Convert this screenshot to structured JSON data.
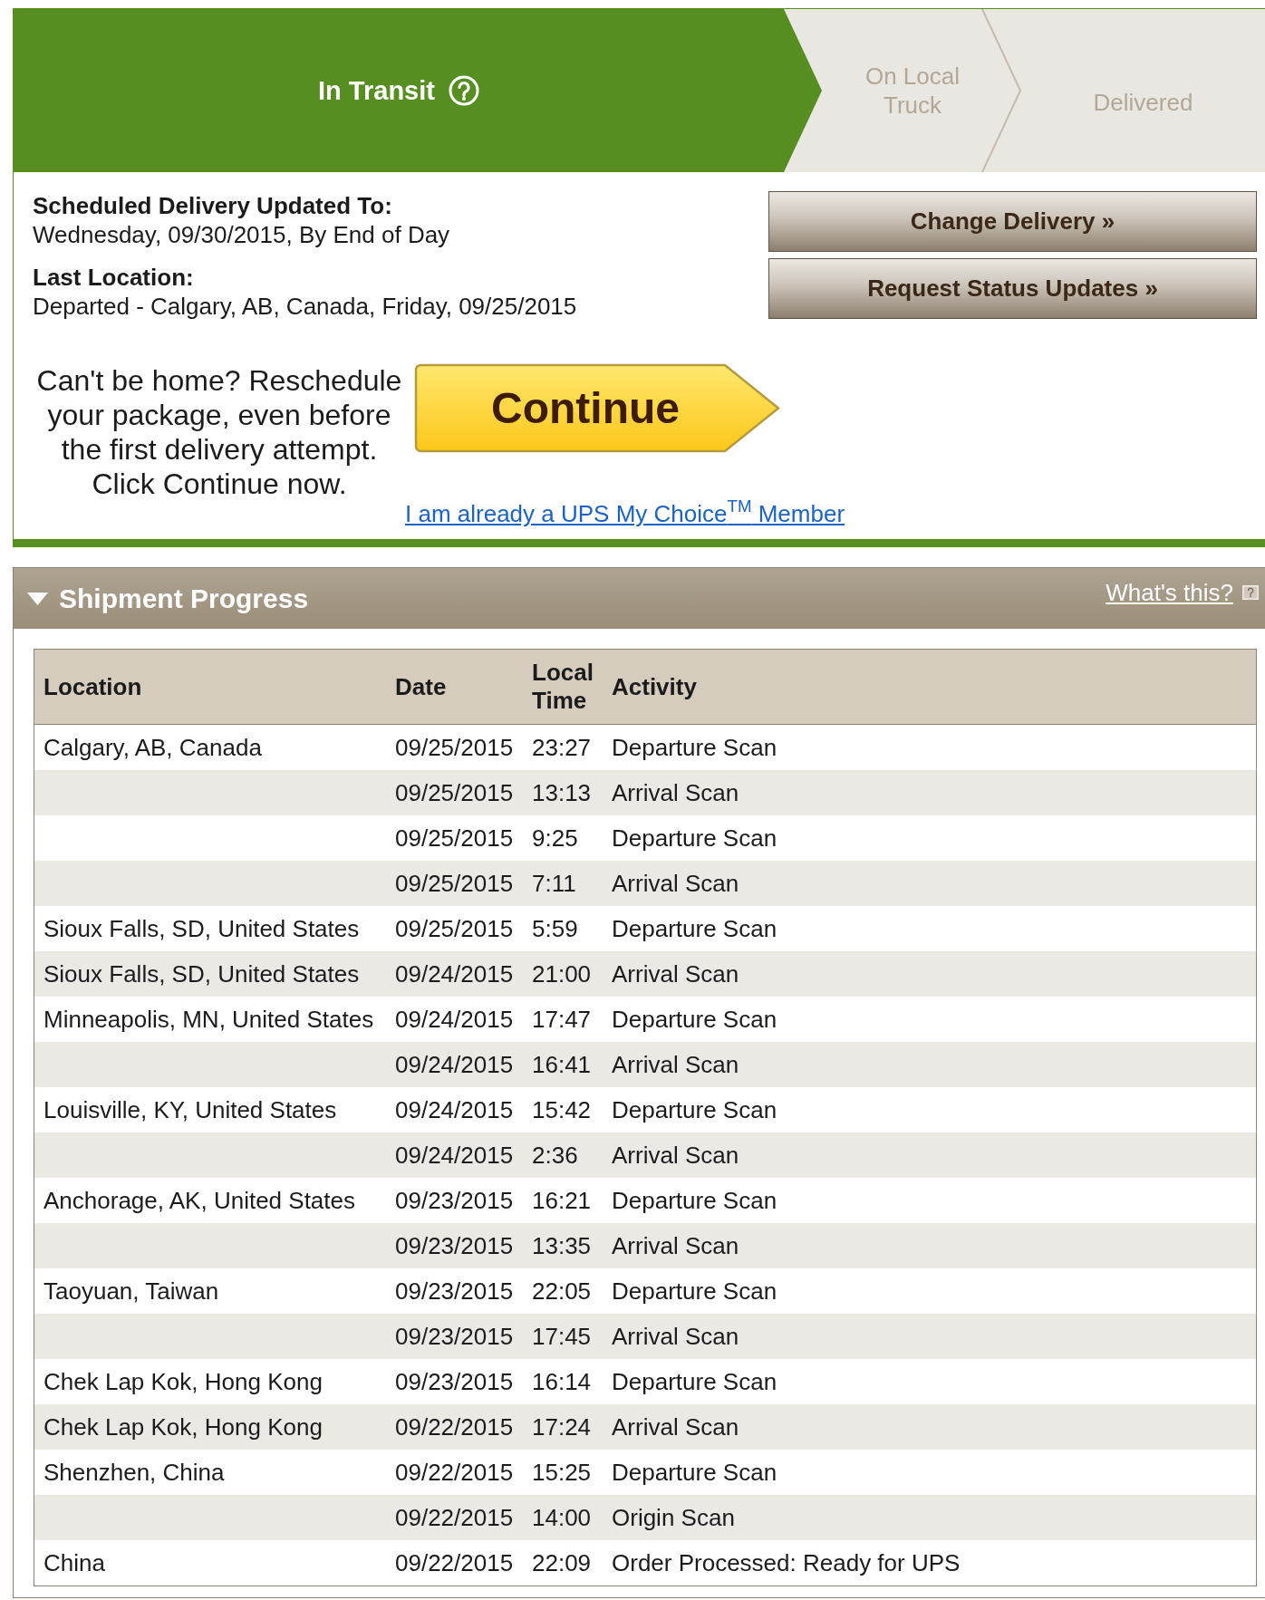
{
  "tracking_steps": [
    {
      "label": "In Transit",
      "selected": true
    },
    {
      "label": "On Local Truck",
      "selected": false
    },
    {
      "label": "Delivered",
      "selected": false
    }
  ],
  "delivery_details": [
    {
      "label": "Scheduled Delivery Updated To:",
      "value": "Wednesday, 09/30/2015, By End of Day"
    },
    {
      "label": "Last Location:",
      "value": "Departed - Calgary, AB, Canada, Friday, 09/25/2015"
    }
  ],
  "actions": [
    "Change Delivery »",
    "Request Status Updates »"
  ],
  "reschedule": {
    "message": "Can't be home? Reschedule your package, even before the first delivery attempt. Click Continue now.",
    "button": "Continue",
    "member_link": "I am already a UPS My Choice$^{TM}$ Member"
  },
  "shipment_progress": {
    "title": "Shipment Progress",
    "expanded": true,
    "help_link": "What's this?",
    "table": {
      "columns": [
        "Location",
        "Date",
        "Local Time",
        "Activity"
      ],
      "rows": [
        {
          "location": "Calgary, AB, Canada",
          "date": "09/25/2015",
          "time": "23:27",
          "activity": "Departure Scan"
        },
        {
          "date": "09/25/2015",
          "time": "13:13",
          "activity": "Arrival Scan"
        },
        {
          "date": "09/25/2015",
          "time": "9:25",
          "activity": "Departure Scan"
        },
        {
          "date": "09/25/2015",
          "time": "7:11",
          "activity": "Arrival Scan"
        },
        {
          "location": "Sioux Falls, SD, United States",
          "date": "09/25/2015",
          "time": "5:59",
          "activity": "Departure Scan"
        },
        {
          "location": "Sioux Falls, SD, United States",
          "date": "09/24/2015",
          "time": "21:00",
          "activity": "Arrival Scan"
        },
        {
          "location": "Minneapolis, MN, United States",
          "date": "09/24/2015",
          "time": "17:47",
          "activity": "Departure Scan"
        },
        {
          "date": "09/24/2015",
          "time": "16:41",
          "activity": "Arrival Scan"
        },
        {
          "location": "Louisville, KY, United States",
          "date": "09/24/2015",
          "time": "15:42",
          "activity": "Departure Scan"
        },
        {
          "date": "09/24/2015",
          "time": "2:36",
          "activity": "Arrival Scan"
        },
        {
          "location": "Anchorage, AK, United States",
          "date": "09/23/2015",
          "time": "16:21",
          "activity": "Departure Scan"
        },
        {
          "date": "09/23/2015",
          "time": "13:35",
          "activity": "Arrival Scan"
        },
        {
          "location": "Taoyuan, Taiwan",
          "date": "09/23/2015",
          "time": "22:05",
          "activity": "Departure Scan"
        },
        {
          "date": "09/23/2015",
          "time": "17:45",
          "activity": "Arrival Scan"
        },
        {
          "location": "Chek Lap Kok, Hong Kong",
          "date": "09/23/2015",
          "time": "16:14",
          "activity": "Departure Scan"
        },
        {
          "location": "Chek Lap Kok, Hong Kong",
          "date": "09/22/2015",
          "time": "17:24",
          "activity": "Arrival Scan"
        },
        {
          "location": "Shenzhen, China",
          "date": "09/22/2015",
          "time": "15:25",
          "activity": "Departure Scan"
        },
        {
          "date": "09/22/2015",
          "time": "14:00",
          "activity": "Origin Scan"
        },
        {
          "location": "China",
          "date": "09/22/2015",
          "time": "22:09",
          "activity": "Order Processed: Ready for UPS"
        }
      ]
    }
  }
}
